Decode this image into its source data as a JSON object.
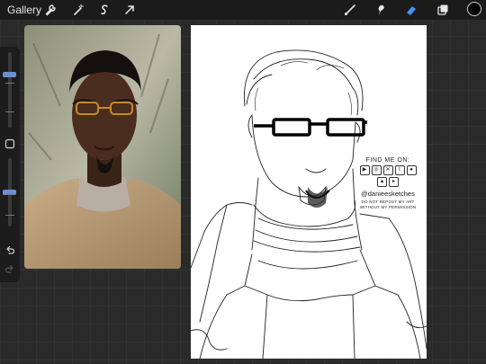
{
  "topbar": {
    "gallery_label": "Gallery",
    "left_tools": [
      "wrench-icon",
      "magic-wand-icon",
      "selection-s-icon",
      "transform-arrow-icon"
    ],
    "right_tools": [
      "brush-icon",
      "smudge-icon",
      "eraser-icon",
      "layers-icon"
    ],
    "active_tool": "eraser-icon",
    "active_tool_color": "#4a8ef5",
    "current_color": "#000000"
  },
  "sidebar": {
    "brush_size_level": 0.72,
    "opacity_level": 0.5,
    "slider_accent_color": "#6c8fd4",
    "buttons": [
      "square-modify-icon",
      "undo-icon",
      "redo-icon"
    ]
  },
  "watermark": {
    "title": "FIND ME ON:",
    "icons": [
      "youtube-icon",
      "instagram-icon",
      "x-icon",
      "tumblr-icon",
      "reddit-icon",
      "artstation-icon",
      "play-icon"
    ],
    "handle": "@danieesketches",
    "note_line1": "DO NOT REPOST MY ART",
    "note_line2": "WITHOUT MY PERMISSION"
  }
}
